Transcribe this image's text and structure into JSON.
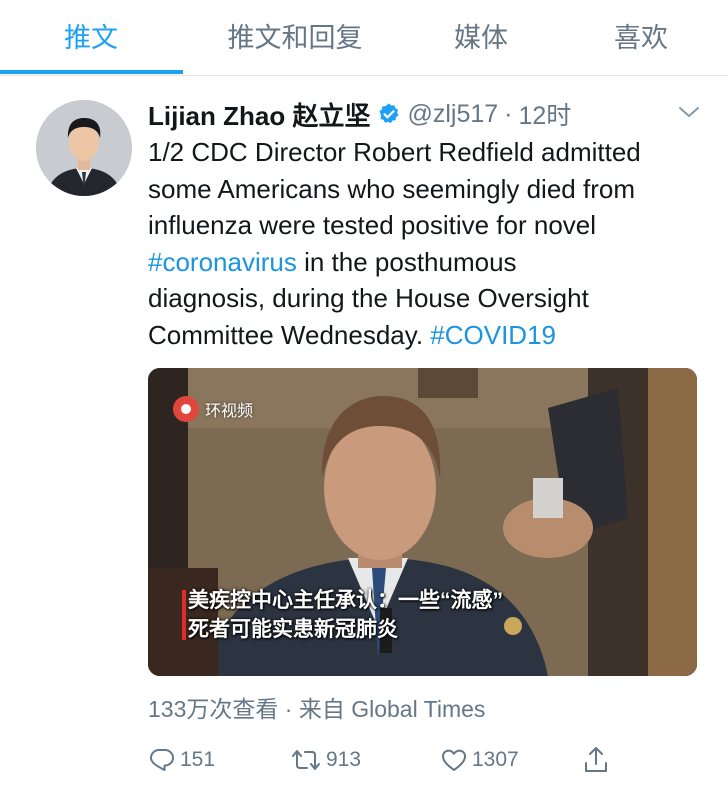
{
  "tabs": [
    {
      "label": "推文",
      "active": true
    },
    {
      "label": "推文和回复",
      "active": false
    },
    {
      "label": "媒体",
      "active": false
    },
    {
      "label": "喜欢",
      "active": false
    }
  ],
  "tweet": {
    "author_name": "Lijian Zhao 赵立坚",
    "verified": true,
    "handle": "@zlj517",
    "separator": "·",
    "time": "12时",
    "text_lines": {
      "l1": "1/2 CDC Director Robert Redfield admitted",
      "l2": "some Americans who seemingly died from",
      "l3": "influenza were tested positive for novel",
      "l4_tag": "#coronavirus",
      "l4_rest": " in the posthumous",
      "l5": "diagnosis, during the House Oversight",
      "l6": "Committee Wednesday.",
      "l6_tag": "#COVID19"
    },
    "media": {
      "watermark": "环视频",
      "caption_line1": "美疾控中心主任承认：一些“流感”",
      "caption_line2": "死者可能实患新冠肺炎"
    },
    "views": "133万次查看",
    "meta_separator": "·",
    "source": "来自 Global Times",
    "actions": {
      "replies": "151",
      "retweets": "913",
      "likes": "1307"
    }
  },
  "colors": {
    "accent": "#1da1f2",
    "link": "#1b95e0",
    "secondary_text": "#657786",
    "caption_bar": "#e22a2a"
  },
  "icons": [
    "verified-badge-icon",
    "chevron-down-icon",
    "video-logo-icon",
    "reply-icon",
    "retweet-icon",
    "like-icon",
    "share-icon"
  ]
}
